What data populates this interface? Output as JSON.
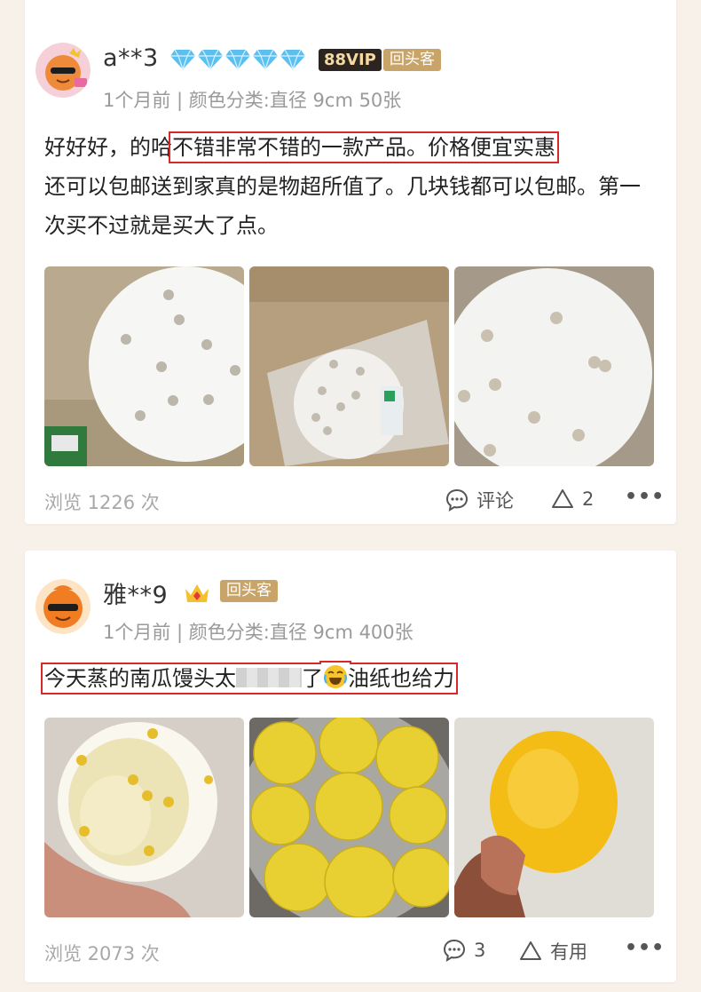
{
  "reviews": [
    {
      "username": "a**3",
      "vip_badge": "88VIP",
      "return_badge": "回头客",
      "meta": "1个月前 | 颜色分类:直径 9cm 50张",
      "text_before": "好好好，的哈",
      "text_highlight": "不错非常不错的一款产品。价格便宜实惠",
      "text_after": "还可以包邮送到家真的是物超所值了。几块钱都可以包邮。第一次买不过就是买大了点。",
      "views": "浏览 1226 次",
      "comment_label": "评论",
      "like_label": "2",
      "more": "•••"
    },
    {
      "username": "雅**9",
      "return_badge": "回头客",
      "meta": "1个月前 | 颜色分类:直径 9cm 400张",
      "text_part1": "今天蒸的南瓜馒头太",
      "text_part2": "了",
      "text_part3": "油纸也给力",
      "views": "浏览 2073 次",
      "comment_label": "3",
      "like_label": "有用",
      "more": "•••"
    }
  ],
  "colors": {
    "background": "#f8f1ea",
    "highlight_border": "#d42a2a",
    "diamond": "#5bc0f0",
    "vip_badge_bg": "#2b2420",
    "return_badge_bg": "#c9a468",
    "meta_text": "#9a9a9a"
  },
  "icons": [
    "diamond-icon",
    "crown-icon",
    "comment-icon",
    "like-triangle-icon",
    "more-icon",
    "laugh-emoji-icon"
  ]
}
